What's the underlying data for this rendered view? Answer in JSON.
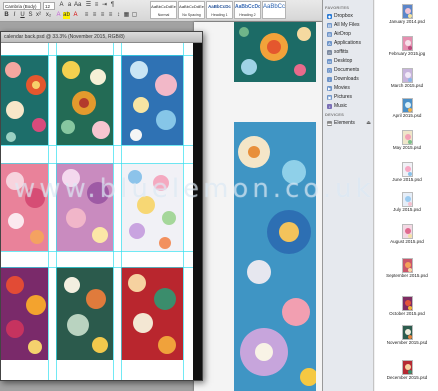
{
  "word": {
    "font_name": "Cambria (Body)",
    "font_size": "12",
    "styles": [
      {
        "sample": "AaBbCcDdEe",
        "name": "Normal",
        "kind": "normal"
      },
      {
        "sample": "AaBbCcDdEe",
        "name": "No Spacing",
        "kind": "normal"
      },
      {
        "sample": "AaBbCcDc",
        "name": "Heading 1",
        "kind": "h1"
      },
      {
        "sample": "AaBbCcDc",
        "name": "Heading 2",
        "kind": "h2"
      },
      {
        "sample": "AaBbCc",
        "name": "",
        "kind": "ttl"
      }
    ]
  },
  "photoshop": {
    "title": "calendar back.psd @ 33.3% (November 2015, RGB/8)"
  },
  "finder": {
    "favorites_label": "FAVORITES",
    "favorites": [
      {
        "label": "Dropbox",
        "icon": "dropbox-icon"
      },
      {
        "label": "All My Files",
        "icon": "all-files-icon"
      },
      {
        "label": "AirDrop",
        "icon": "airdrop-icon"
      },
      {
        "label": "Applications",
        "icon": "applications-icon"
      },
      {
        "label": "soffitts",
        "icon": "home-icon"
      },
      {
        "label": "Desktop",
        "icon": "desktop-icon"
      },
      {
        "label": "Documents",
        "icon": "documents-icon"
      },
      {
        "label": "Downloads",
        "icon": "downloads-icon"
      },
      {
        "label": "Movies",
        "icon": "movies-icon"
      },
      {
        "label": "Pictures",
        "icon": "pictures-icon"
      },
      {
        "label": "Music",
        "icon": "music-icon"
      }
    ],
    "devices_label": "DEVICES",
    "devices": [
      {
        "label": "Elements",
        "icon": "drive-icon"
      }
    ],
    "files": [
      {
        "name": "January 2014.psd"
      },
      {
        "name": "February 2015.jpg"
      },
      {
        "name": "March 2015.psd"
      },
      {
        "name": "April 2015.psd"
      },
      {
        "name": "May 2015.psd"
      },
      {
        "name": "June 2015.psd"
      },
      {
        "name": "July 2015.psd"
      },
      {
        "name": "August 2015.psd"
      },
      {
        "name": "September 2015.psd"
      },
      {
        "name": "October 2015.psd"
      },
      {
        "name": "November 2015.psd"
      },
      {
        "name": "December 2015.psd"
      }
    ]
  },
  "watermark": "www.bluelemon.co.uk",
  "colors": {
    "cyan_guides": "#34e0f0",
    "finder_selection": "#2b7bd5"
  }
}
